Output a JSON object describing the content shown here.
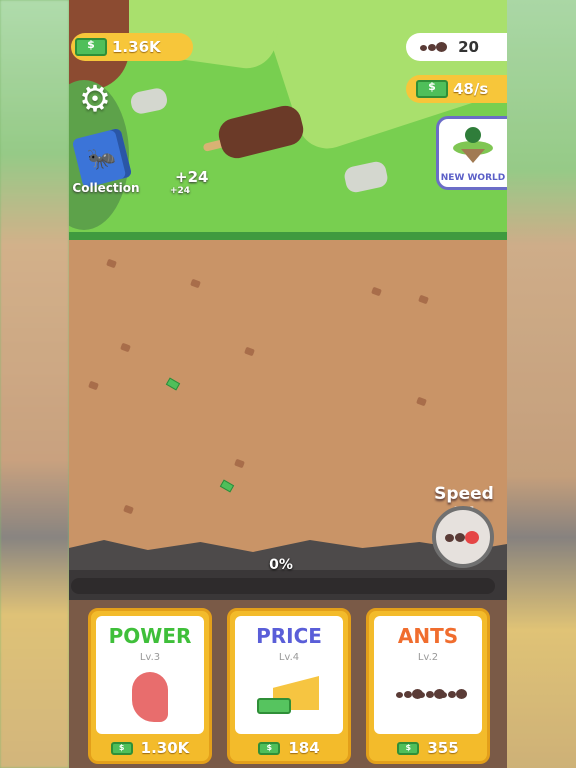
{
  "hud": {
    "money": "1.36K",
    "ant_count": "20",
    "income_rate": "48/s",
    "collection_label": "Collection",
    "new_world_label": "NEW WORLD"
  },
  "floating_texts": {
    "big_gain": "+24",
    "small_gain": "+24"
  },
  "progress": {
    "label": "0%",
    "value": 0
  },
  "speed": {
    "label": "Speed !!!"
  },
  "cards": [
    {
      "title": "POWER",
      "level": "Lv.3",
      "price": "1.30K",
      "title_color": "#3fbf3a"
    },
    {
      "title": "PRICE",
      "level": "Lv.4",
      "price": "184",
      "title_color": "#5a5ed8"
    },
    {
      "title": "ANTS",
      "level": "Lv.2",
      "price": "355",
      "title_color": "#f06d2e"
    }
  ],
  "icons": {
    "settings": "gear-icon",
    "collection": "book-icon",
    "ant": "ant-icon",
    "money": "cash-icon"
  },
  "colors": {
    "grass": "#78cf50",
    "dirt": "#c99467",
    "gold": "#f7c63a"
  }
}
